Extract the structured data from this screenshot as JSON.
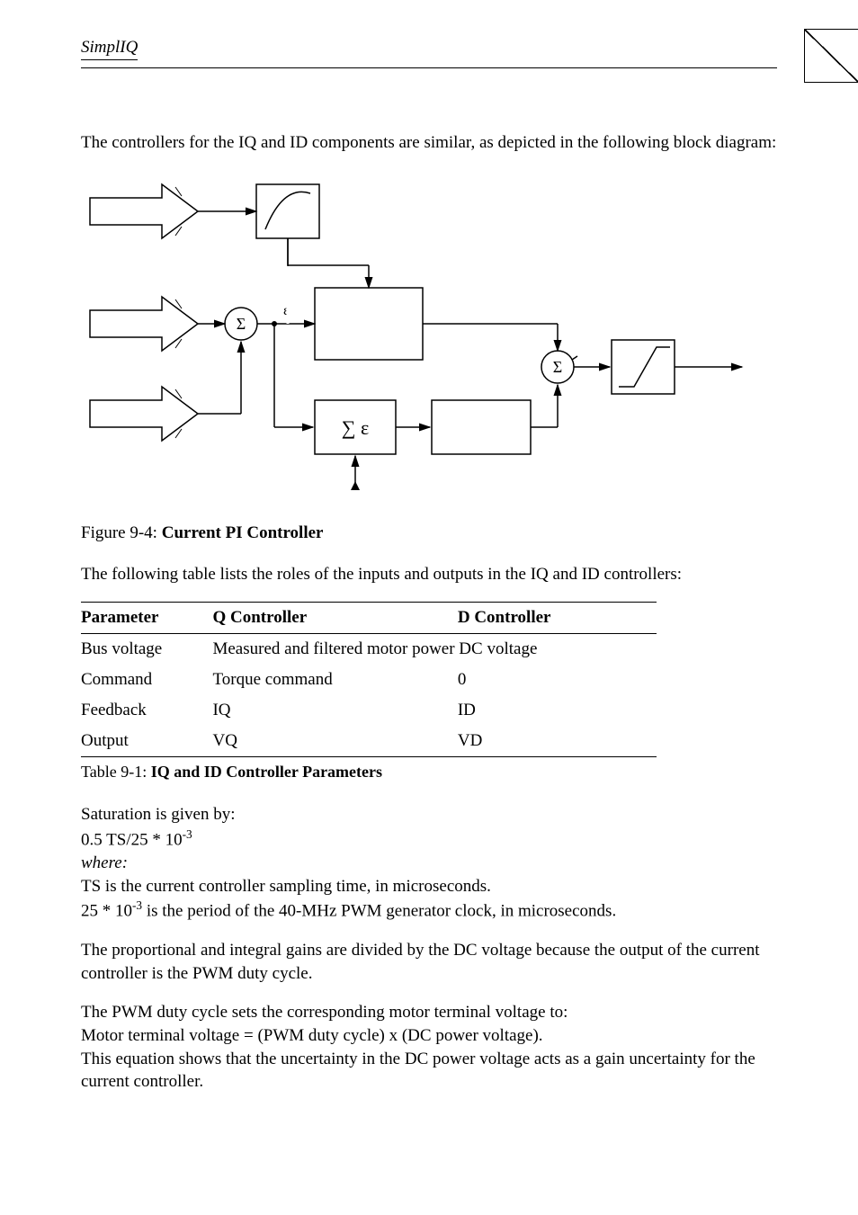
{
  "header": {
    "running": "SimplIQ"
  },
  "intro": "The controllers for the IQ and ID components are similar, as depicted in the following block diagram:",
  "diagram": {
    "sigma": "Σ",
    "eps": "ε",
    "sumeps": "∑ ε"
  },
  "figcap": {
    "label": "Figure 9-4: ",
    "title": "Current PI Controller"
  },
  "tableintro": "The following table lists the roles of the inputs and outputs in the IQ and ID controllers:",
  "table": {
    "headers": {
      "param": "Parameter",
      "q": "Q Controller",
      "d": "D Controller"
    },
    "rows": [
      {
        "param": "Bus voltage",
        "q": "Measured and filtered motor power DC voltage",
        "d": "",
        "span": true
      },
      {
        "param": "Command",
        "q": "Torque command",
        "d": "0"
      },
      {
        "param": "Feedback",
        "q": "IQ",
        "d": "ID"
      },
      {
        "param": "Output",
        "q": "VQ",
        "d": "VD"
      }
    ]
  },
  "tablecap": {
    "label": "Table 9-1: ",
    "title": "IQ and ID Controller Parameters"
  },
  "sat": {
    "line1": "Saturation is given by:",
    "line2a": "0.5 TS/25 * 10",
    "line2exp": "-3",
    "where": "where:",
    "ts": "TS is the current controller sampling time, in microseconds.",
    "periodA": "25 * 10",
    "periodExp": "-3",
    "periodB": " is the period of the 40-MHz PWM generator clock, in microseconds."
  },
  "gain": "The proportional and integral gains are divided by the DC voltage because the output of the current controller is the PWM duty cycle.",
  "pwm": {
    "l1": "The PWM duty cycle sets the corresponding motor terminal voltage to:",
    "l2": "Motor terminal voltage = (PWM duty cycle) x (DC power voltage).",
    "l3": "This equation shows that the uncertainty in the DC power voltage acts as a gain uncertainty for the current controller."
  }
}
